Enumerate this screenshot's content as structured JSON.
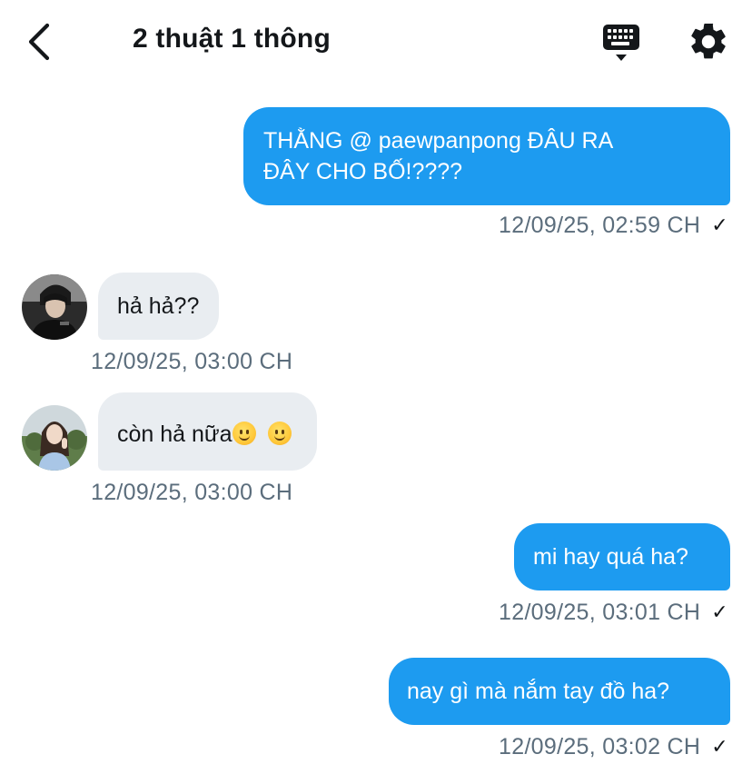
{
  "header": {
    "title": "2 thuật 1 thông",
    "icons": [
      "chevron-left-icon",
      "keyboard-icon",
      "gear-icon"
    ]
  },
  "messages": [
    {
      "direction": "out",
      "text_line1": "THẰNG @ paewpanpong ĐÂU RA",
      "text_line2": "ĐÂY CHO BỐ!????",
      "timestamp": "12/09/25, 02:59 CH",
      "status": "✓"
    },
    {
      "direction": "in",
      "text": "hả hả??",
      "timestamp": "12/09/25, 03:00 CH"
    },
    {
      "direction": "in",
      "text": "còn hả nữa",
      "timestamp": "12/09/25, 03:00 CH",
      "emojis": [
        "slightly-smiling-face",
        "slightly-smiling-face"
      ]
    },
    {
      "direction": "out",
      "text": "mi hay quá ha?",
      "timestamp": "12/09/25, 03:01 CH",
      "status": "✓"
    },
    {
      "direction": "out",
      "text": "nay gì mà nắm tay đồ ha?",
      "timestamp": "12/09/25, 03:02 CH",
      "status": "✓"
    }
  ],
  "colors": {
    "outgoing_bubble": "#1d9bf0",
    "incoming_bubble": "#e9edf1",
    "timestamp_text": "#5b6d7c"
  }
}
